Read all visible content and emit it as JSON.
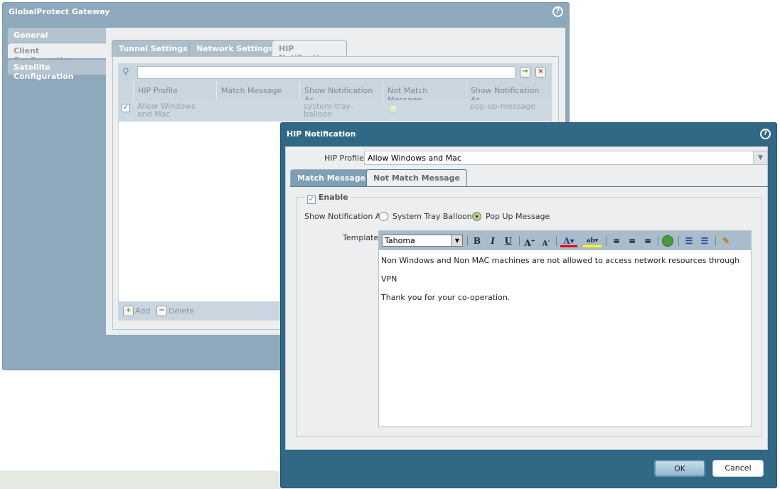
{
  "gateway": {
    "title": "GlobalProtect Gateway",
    "side_tabs": [
      "General",
      "Client Configuration",
      "Satellite Configuration"
    ],
    "tabs": [
      "Tunnel Settings",
      "Network Settings",
      "HIP Notification"
    ],
    "search": {
      "value": "",
      "placeholder": ""
    },
    "columns": [
      "HIP Profile",
      "Match Message",
      "Show Notification As",
      "Not Match Message",
      "Show Notification As"
    ],
    "rows": [
      {
        "hip_profile": "Allow Windows and Mac",
        "match_message": "",
        "match_show_as": "system-tray-balloon",
        "not_match_message": "checked",
        "not_match_show_as": "pop-up-message"
      }
    ],
    "add_label": "Add",
    "delete_label": "Delete"
  },
  "dialog": {
    "title": "HIP Notification",
    "hip_profile_label": "HIP Profile",
    "hip_profile_value": "Allow Windows and Mac",
    "tabs": [
      "Match Message",
      "Not Match Message"
    ],
    "enable_label": "Enable",
    "show_as_label": "Show Notification As",
    "options": [
      "System Tray Balloon",
      "Pop Up Message"
    ],
    "selected_option": "Pop Up Message",
    "template_label": "Template",
    "font": "Tahoma",
    "message_lines": [
      "Non Windows and Non MAC machines are not allowed to access network resources through VPN",
      "Thank you for your co-operation."
    ],
    "ok_label": "OK",
    "cancel_label": "Cancel"
  },
  "colors": {
    "dialog_bg": "#306886",
    "outer_bg": "#8ea9bc"
  }
}
